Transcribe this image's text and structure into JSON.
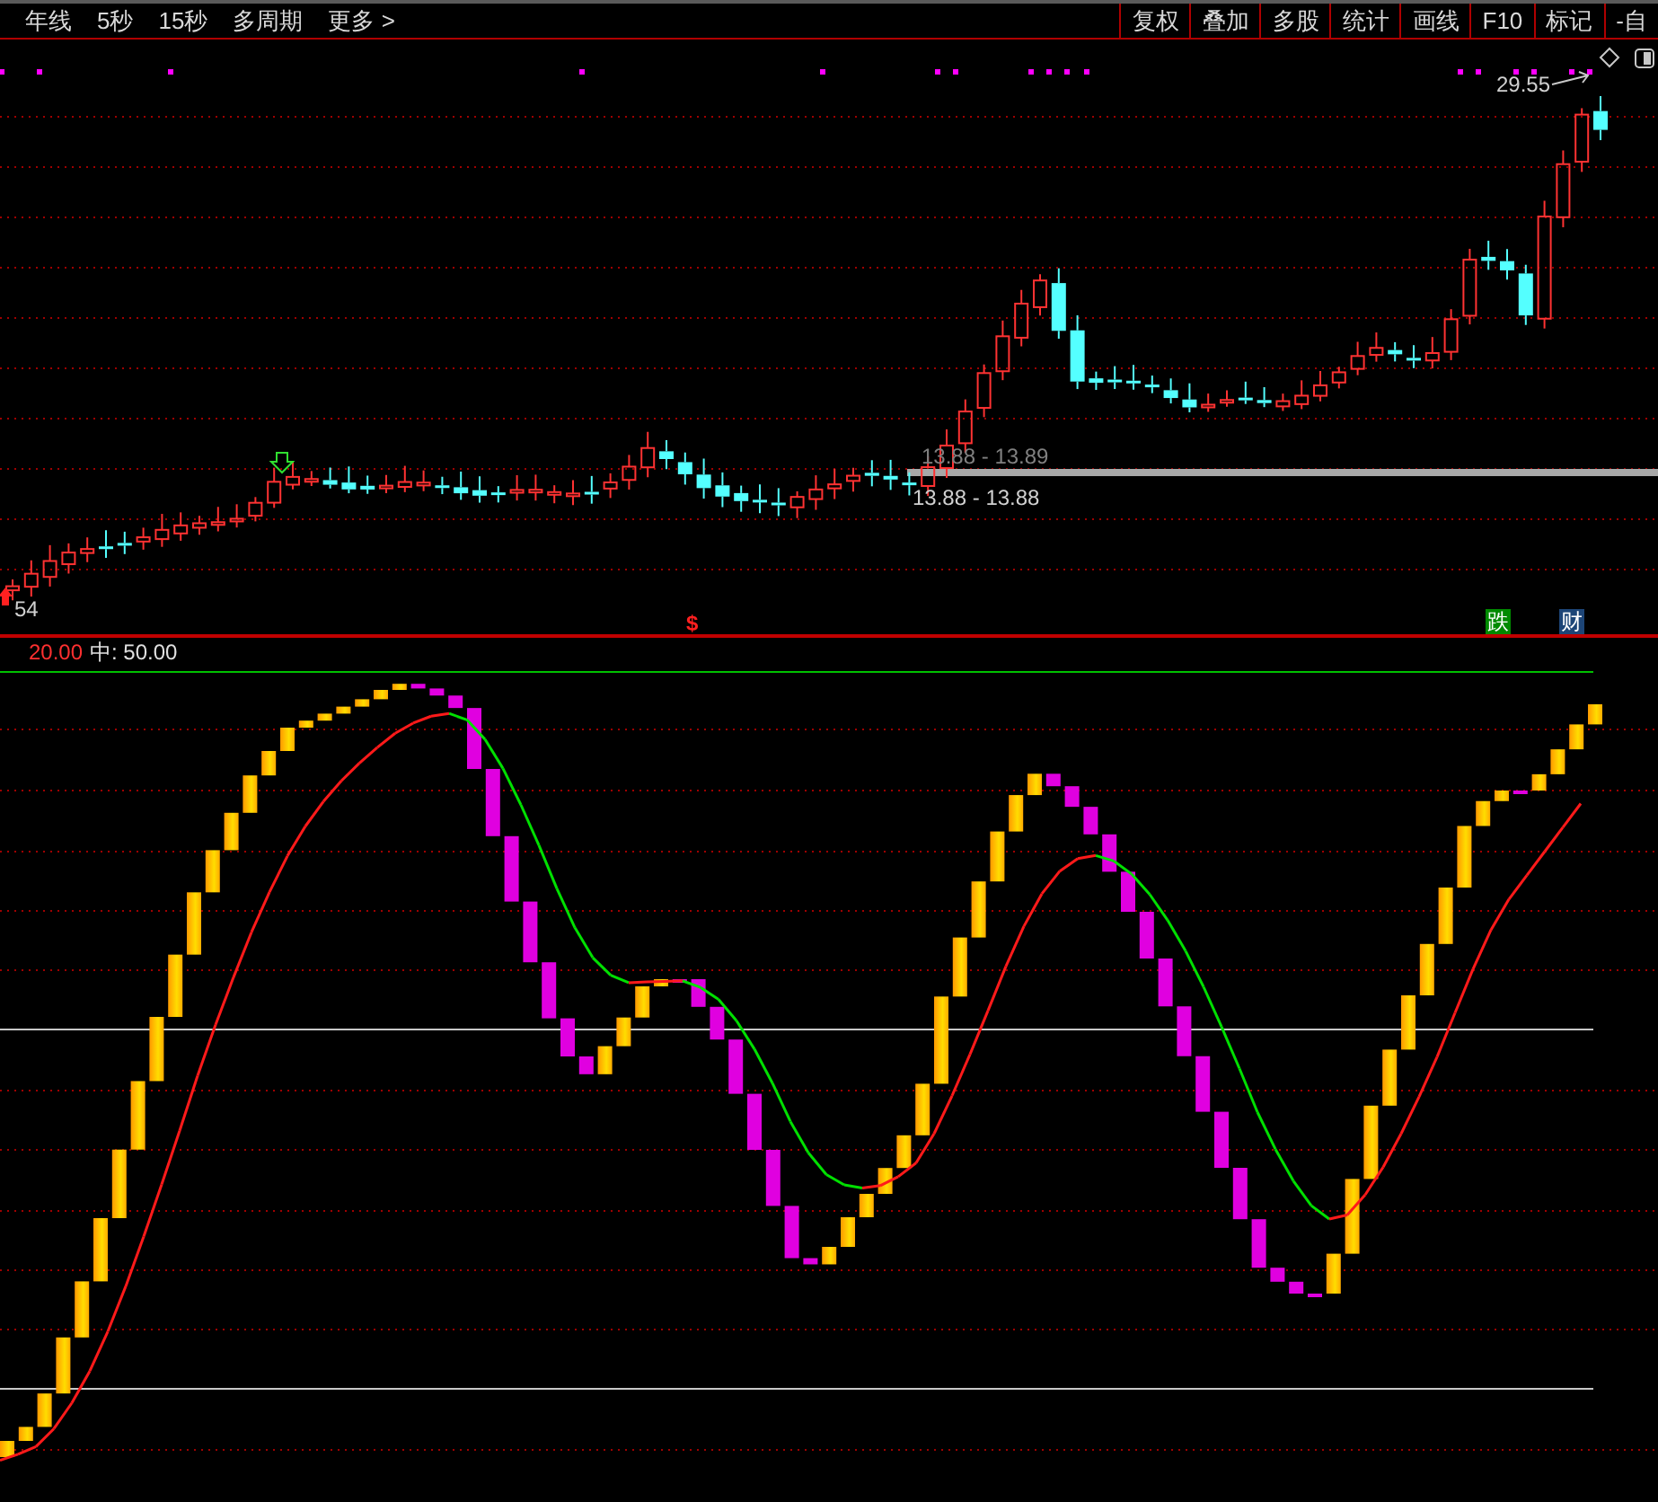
{
  "toolbar": {
    "left_items": [
      "年线",
      "5秒",
      "15秒",
      "多周期",
      "更多 >"
    ],
    "right_buttons": [
      "复权",
      "叠加",
      "多股",
      "统计",
      "画线",
      "F10",
      "标记",
      "-自"
    ]
  },
  "price_chart": {
    "high_label": "29.55",
    "range_labels": [
      {
        "kind": "faded",
        "text": "13.88 - 13.89"
      },
      {
        "kind": "current",
        "text": "13.88 - 13.88"
      }
    ],
    "low_label": "54",
    "sell_marker": "$",
    "badges": [
      {
        "text": "跌",
        "color": "#008a00"
      },
      {
        "text": "财",
        "color": "#1d4577"
      }
    ]
  },
  "indicator": {
    "labels": [
      {
        "kind": "low",
        "text": "20.00"
      },
      {
        "kind": "mid",
        "text": "中: 50.00"
      }
    ]
  }
}
